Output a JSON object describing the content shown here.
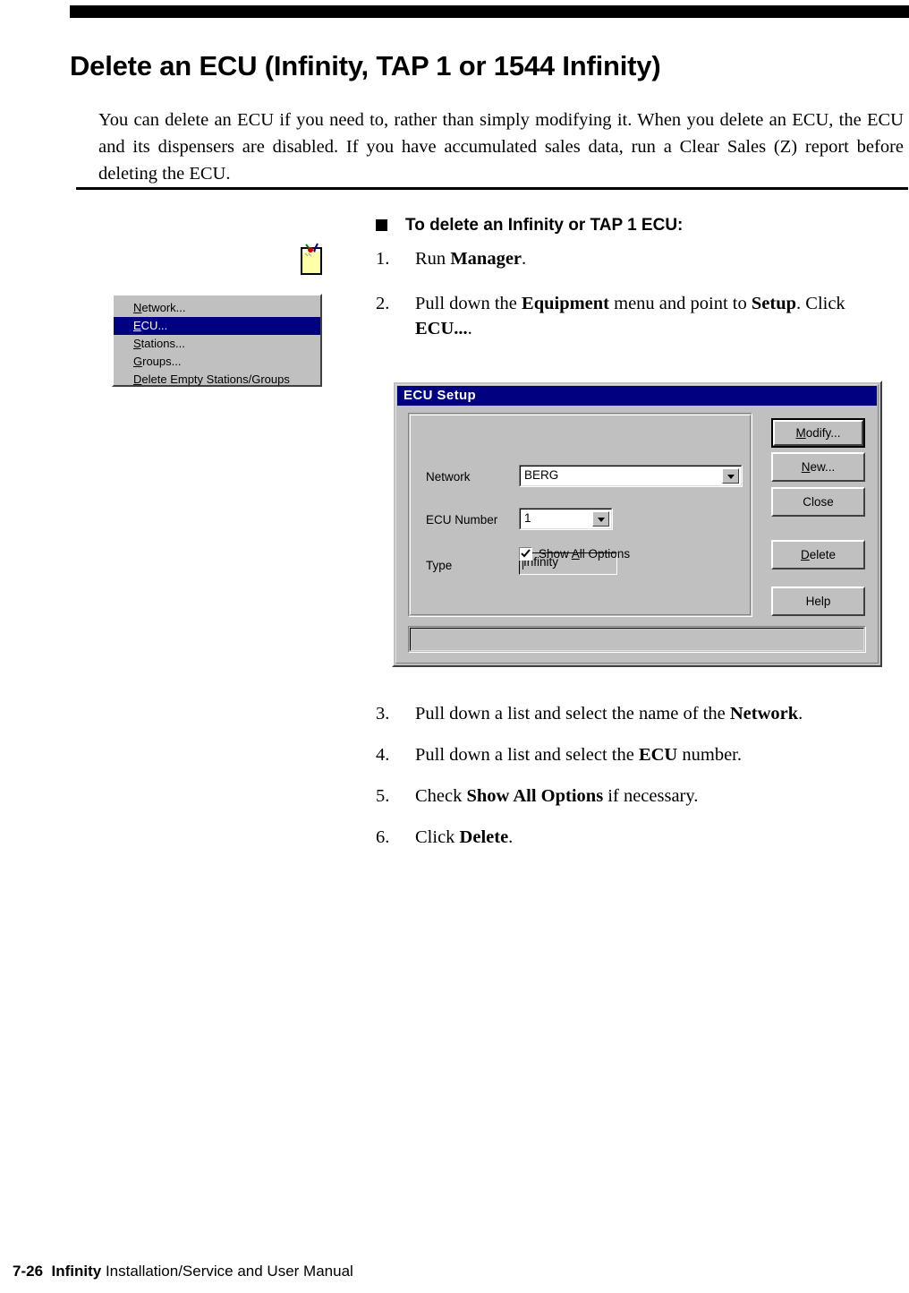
{
  "page": {
    "title": "Delete an ECU (Infinity, TAP 1 or 1544 Infinity)",
    "intro": "You can delete an ECU if you need to, rather than simply modifying it. When you delete an ECU, the ECU and its dispensers are disabled. If you have accumulated sales data, run a Clear Sales (Z) report before deleting the ECU.",
    "note_icon": "note-pad-icon"
  },
  "procedure": {
    "heading": "To delete an Infinity or TAP 1 ECU:",
    "bullet": "square-bullet",
    "steps": [
      {
        "num": "1.",
        "prefix": "Run ",
        "bold1": "Manager",
        "suffix": "."
      },
      {
        "num": "2.",
        "prefix": "Pull down the ",
        "bold1": "Equipment",
        "mid": " menu and point to ",
        "bold2": "Setup",
        "mid2": ". Click ",
        "bold3": "ECU...",
        "suffix": "."
      },
      {
        "num": "3.",
        "prefix": "Pull down a list and select the name of the ",
        "bold1": "Network",
        "suffix": "."
      },
      {
        "num": "4.",
        "prefix": "Pull down a list and select the ",
        "bold1": "ECU",
        "suffix": " number."
      },
      {
        "num": "5.",
        "prefix": "Check ",
        "bold1": "Show All Options",
        "suffix": " if necessary."
      },
      {
        "num": "6.",
        "prefix": "Click ",
        "bold1": "Delete",
        "suffix": "."
      }
    ]
  },
  "menu_screenshot": {
    "name": "equipment-setup-submenu",
    "items": [
      {
        "accel": "N",
        "rest": "etwork...",
        "selected": false
      },
      {
        "accel": "E",
        "rest": "CU...",
        "selected": true
      },
      {
        "accel": "S",
        "rest": "tations...",
        "selected": false
      },
      {
        "accel": "G",
        "rest": "roups...",
        "selected": false
      },
      {
        "accel": "D",
        "rest": "elete Empty Stations/Groups",
        "selected": false
      }
    ],
    "highlight_color": "#000080",
    "face_color": "#c0c0c0"
  },
  "dialog": {
    "title": "ECU Setup",
    "titlebar_color": "#000080",
    "face_color": "#c0c0c0",
    "fields": {
      "network": {
        "label": "Network",
        "value": "BERG"
      },
      "ecu_number": {
        "label": "ECU Number",
        "value": "1"
      },
      "type": {
        "label": "Type",
        "value": "Infinity"
      }
    },
    "checkbox": {
      "accel_prefix": "Show ",
      "accel": "A",
      "accel_rest": "ll Options",
      "checked": true
    },
    "buttons": [
      {
        "accel_prefix": "",
        "accel": "M",
        "accel_rest": "odify...",
        "default": true
      },
      {
        "accel_prefix": "",
        "accel": "N",
        "accel_rest": "ew...",
        "default": false
      },
      {
        "accel_prefix": "Close",
        "accel": "",
        "accel_rest": "",
        "default": false
      },
      {
        "accel_prefix": "",
        "accel": "D",
        "accel_rest": "elete",
        "default": false
      },
      {
        "accel_prefix": "Help",
        "accel": "",
        "accel_rest": "",
        "default": false
      }
    ],
    "statusbar_text": ""
  },
  "footer": {
    "page_number": "7-26",
    "product": "Infinity",
    "manual": "Installation/Service and User Manual"
  }
}
